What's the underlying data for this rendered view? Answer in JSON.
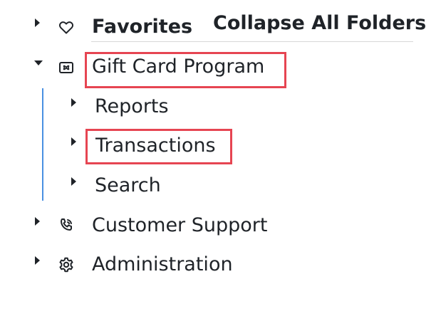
{
  "toolbar": {
    "collapse_all_label": "Collapse All Folders"
  },
  "tree": {
    "favorites": {
      "label": "Favorites",
      "icon": "heart-icon",
      "expanded": false
    },
    "gift_card_program": {
      "label": "Gift Card Program",
      "icon": "gift-card-icon",
      "expanded": true,
      "children": [
        {
          "label": "Reports",
          "expanded": false
        },
        {
          "label": "Transactions",
          "expanded": false
        },
        {
          "label": "Search",
          "expanded": false
        }
      ]
    },
    "customer_support": {
      "label": "Customer Support",
      "icon": "phone-icon",
      "expanded": false
    },
    "administration": {
      "label": "Administration",
      "icon": "gear-icon",
      "expanded": false
    }
  },
  "colors": {
    "text": "#1f2328",
    "highlight": "#e64552",
    "guide_line": "#4a90e2",
    "divider": "#d8d8d8"
  }
}
